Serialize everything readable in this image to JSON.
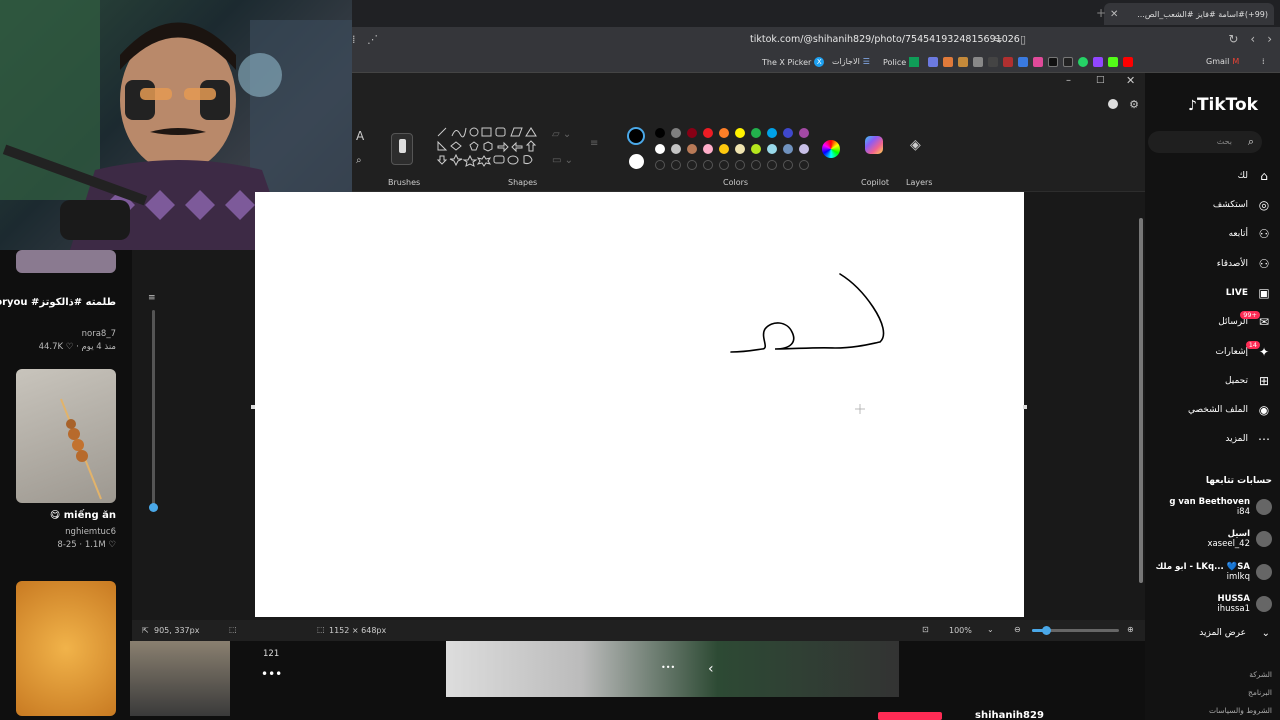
{
  "browser": {
    "tab_title": "(99+)#اسامة #فايز #الشعب_الص...",
    "url": "tiktok.com/@shihanih829/photo/7545419324815691026",
    "bookmarks": [
      "Gmail",
      "Police",
      "الاجازات",
      "The X Picker"
    ]
  },
  "left_feed": {
    "items": [
      {
        "title": "falcons #fyp# #foryou #طلمته #ذالكوتز",
        "user": "nora8_7",
        "meta": "44.7K ♡ · منذ 4 يوم"
      },
      {
        "title": "😋 miếng ăn",
        "user": "nghiemtuc6",
        "meta": "8-25 · 1.1M ♡"
      }
    ]
  },
  "paint": {
    "groups": {
      "brushes": "Brushes",
      "shapes": "Shapes",
      "colors": "Colors",
      "copilot": "Copilot",
      "layers": "Layers"
    },
    "colors_row1": [
      "#000000",
      "#7f7f7f",
      "#880015",
      "#ed1c24",
      "#ff7f27",
      "#fff200",
      "#22b14c",
      "#00a2e8",
      "#3f48cc",
      "#a349a4"
    ],
    "colors_row2": [
      "#ffffff",
      "#c3c3c3",
      "#b97a57",
      "#ffaec9",
      "#ffc90e",
      "#efe4b0",
      "#b5e61d",
      "#99d9ea",
      "#7092be",
      "#c8bfe7"
    ],
    "status": {
      "cursor": "905, 337px",
      "size": "1152 × 648px",
      "zoom": "100%"
    }
  },
  "tiktok": {
    "logo": "TikTok",
    "search_placeholder": "بحث",
    "nav": [
      {
        "label": "لك",
        "icon": "home-icon"
      },
      {
        "label": "استكشف",
        "icon": "compass-icon"
      },
      {
        "label": "أتابعه",
        "icon": "user-follow-icon"
      },
      {
        "label": "الأصدقاء",
        "icon": "friends-icon"
      },
      {
        "label": "LIVE",
        "icon": "live-icon"
      },
      {
        "label": "الرسائل",
        "icon": "messages-icon",
        "badge": "99+"
      },
      {
        "label": "إشعارات",
        "icon": "bell-icon",
        "badge": "14"
      },
      {
        "label": "تحميل",
        "icon": "upload-icon"
      },
      {
        "label": "الملف الشخصي",
        "icon": "profile-icon"
      },
      {
        "label": "المزيد",
        "icon": "more-icon"
      }
    ],
    "following_title": "حسابات تتابعها",
    "following": [
      {
        "name": "g van Beethoven",
        "handle": "i84"
      },
      {
        "name": "اسيل",
        "handle": "xaseel_42"
      },
      {
        "name": "ابو ملك - LKq... 💙SA",
        "handle": "imlkq"
      },
      {
        "name": "HUSSA",
        "handle": "ihussa1"
      }
    ],
    "see_more": "عرض المزيد",
    "footer": [
      "الشركة",
      "البرنامج",
      "الشروط والسياسات"
    ],
    "comment_count": "121",
    "username": "shihanih829"
  }
}
